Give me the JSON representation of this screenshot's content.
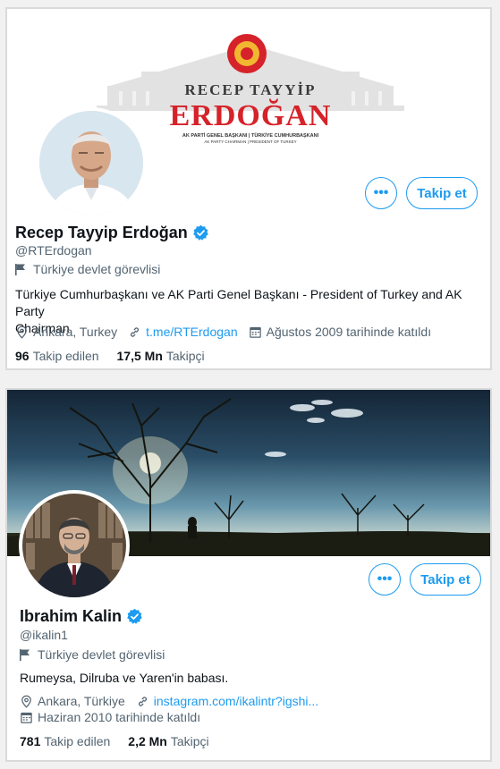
{
  "profiles": [
    {
      "banner": {
        "first_name": "RECEP TAYYİP",
        "last_name": "ERDOĞAN",
        "line1": "AK PARTİ GENEL BAŞKANI | TÜRKİYE CUMHURBAŞKANI",
        "line2": "AK PARTY CHAIRMAN | PRESIDENT OF TURKEY"
      },
      "more_label": "•••",
      "follow_label": "Takip et",
      "name": "Recep Tayyip Erdoğan",
      "handle": "@RTErdogan",
      "category": "Türkiye devlet görevlisi",
      "bio_line1": "Türkiye Cumhurbaşkanı ve AK Parti Genel Başkanı - President of Turkey and AK Party",
      "bio_line2": "Chairman",
      "location": "Ankara, Turkey",
      "website": "t.me/RTErdogan",
      "joined": "Ağustos 2009 tarihinde katıldı",
      "following_count": "96",
      "following_label": "Takip edilen",
      "followers_count": "17,5 Mn",
      "followers_label": "Takipçi"
    },
    {
      "more_label": "•••",
      "follow_label": "Takip et",
      "name": "Ibrahim Kalin",
      "handle": "@ikalin1",
      "category": "Türkiye devlet görevlisi",
      "bio_line1": "Rumeysa, Dilruba ve Yaren'in babası.",
      "location": "Ankara, Türkiye",
      "website": "instagram.com/ikalintr?igshi...",
      "joined": "Haziran 2010 tarihinde katıldı",
      "following_count": "781",
      "following_label": "Takip edilen",
      "followers_count": "2,2 Mn",
      "followers_label": "Takipçi"
    }
  ],
  "colors": {
    "accent": "#1d9bf0",
    "text": "#0f1419",
    "muted": "#536471",
    "brand_red": "#d6222a"
  }
}
